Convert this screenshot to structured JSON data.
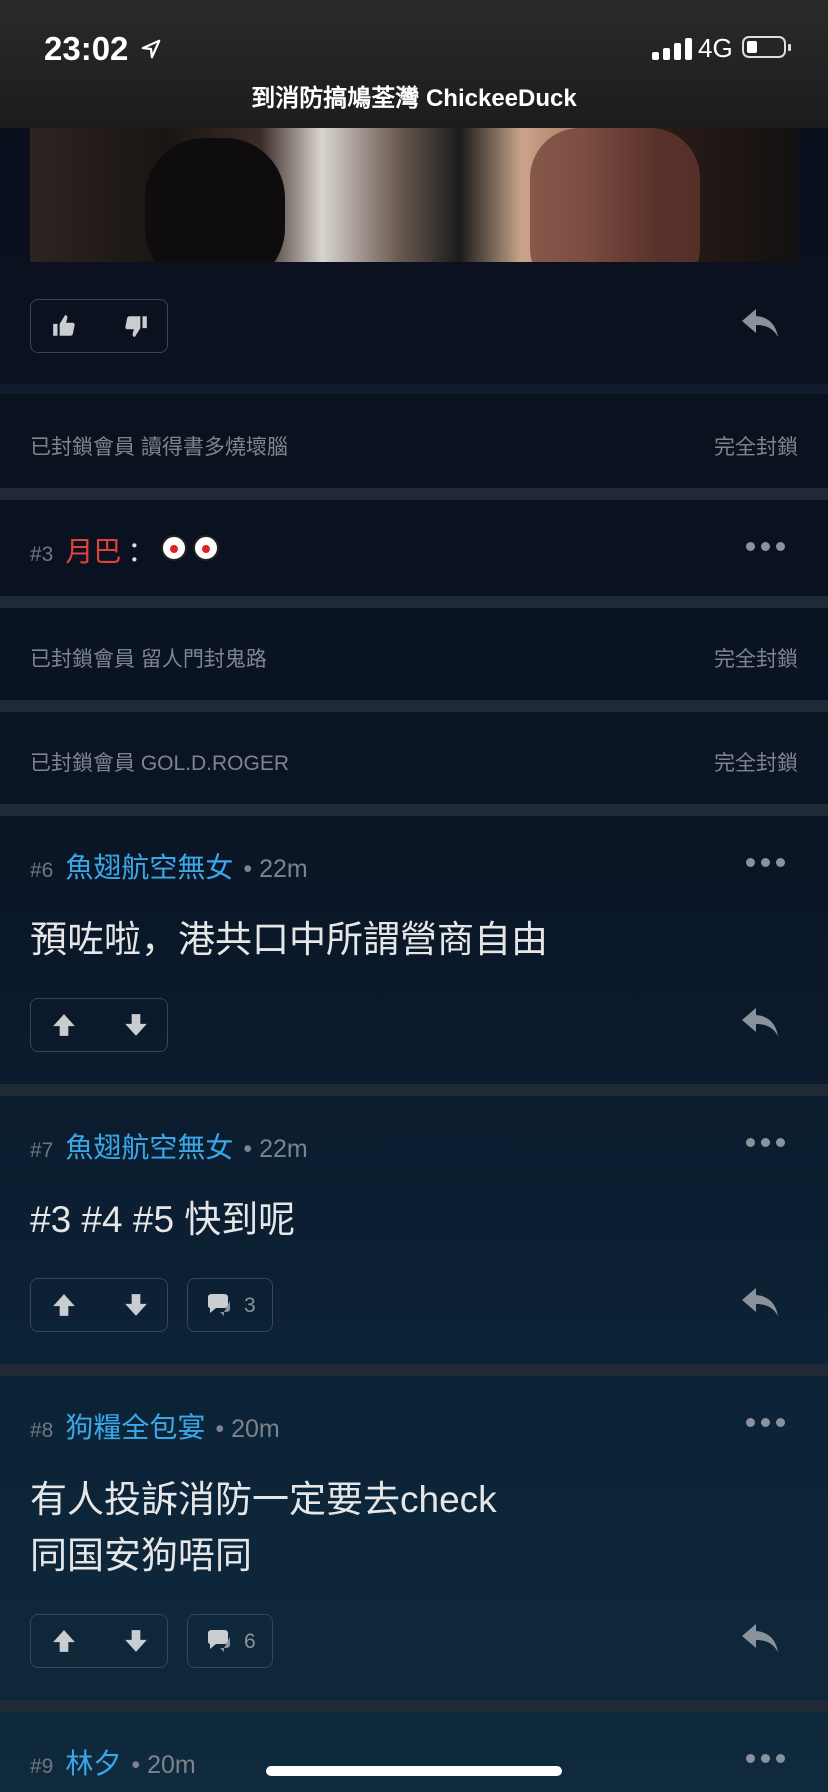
{
  "status_bar": {
    "time": "23:02",
    "network": "4G"
  },
  "thread_title": "到消防搞鳩荃灣 ChickeeDuck",
  "blocked_rows": [
    {
      "label": "已封鎖會員 讀得書多燒壞腦",
      "action": "完全封鎖"
    },
    {
      "label": "已封鎖會員 留人門封鬼路",
      "action": "完全封鎖"
    },
    {
      "label": "已封鎖會員 GOL.D.ROGER",
      "action": "完全封鎖"
    }
  ],
  "posts": [
    {
      "number": "#3",
      "user": "月巴",
      "separator": "：",
      "icons": [
        "clown-face-icon",
        "clown-face-icon"
      ]
    },
    {
      "number": "#6",
      "user": "魚翅航空無女",
      "time": "• 22m",
      "body": [
        "預咗啦，港共口中所謂營商自由"
      ]
    },
    {
      "number": "#7",
      "user": "魚翅航空無女",
      "time": "• 22m",
      "body": [
        "#3 #4 #5 快到呢"
      ],
      "comments": "3"
    },
    {
      "number": "#8",
      "user": "狗糧全包宴",
      "time": "• 20m",
      "body": [
        "有人投訴消防一定要去check",
        "同国安狗唔同"
      ],
      "comments": "6"
    },
    {
      "number": "#9",
      "user": "林夕",
      "time": "• 20m"
    }
  ],
  "colors": {
    "username": "#3aa8e8",
    "username_red": "#e0423a",
    "accent_gray": "#8a929c"
  }
}
